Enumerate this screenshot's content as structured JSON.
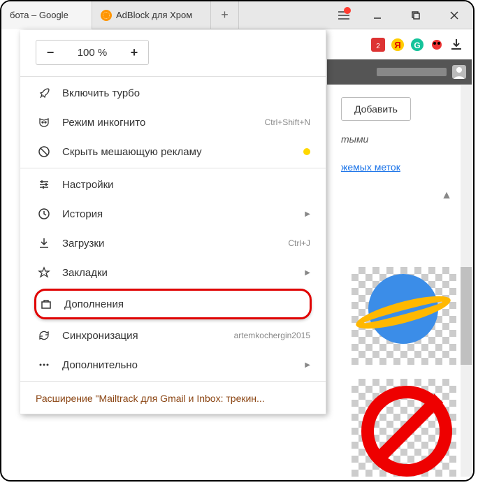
{
  "tabs": [
    {
      "title": "бота – Google",
      "favicon": "#4285f4"
    },
    {
      "title": "AdBlock для Хром",
      "favicon": "#ff8800"
    }
  ],
  "zoom": {
    "minus": "−",
    "value": "100 %",
    "plus": "+"
  },
  "menu": {
    "turbo": "Включить турбо",
    "incognito": "Режим инкогнито",
    "incognito_hint": "Ctrl+Shift+N",
    "hide_ads": "Скрыть мешающую рекламу",
    "settings": "Настройки",
    "history": "История",
    "downloads": "Загрузки",
    "downloads_hint": "Ctrl+J",
    "bookmarks": "Закладки",
    "addons": "Дополнения",
    "sync": "Синхронизация",
    "sync_hint": "artemkochergin2015",
    "more": "Дополнительно"
  },
  "promo": "Расширение \"Mailtrack для Gmail и Inbox: трекин...",
  "page": {
    "add_button": "Добавить",
    "text1": "тыми",
    "link1": "жемых меток"
  }
}
